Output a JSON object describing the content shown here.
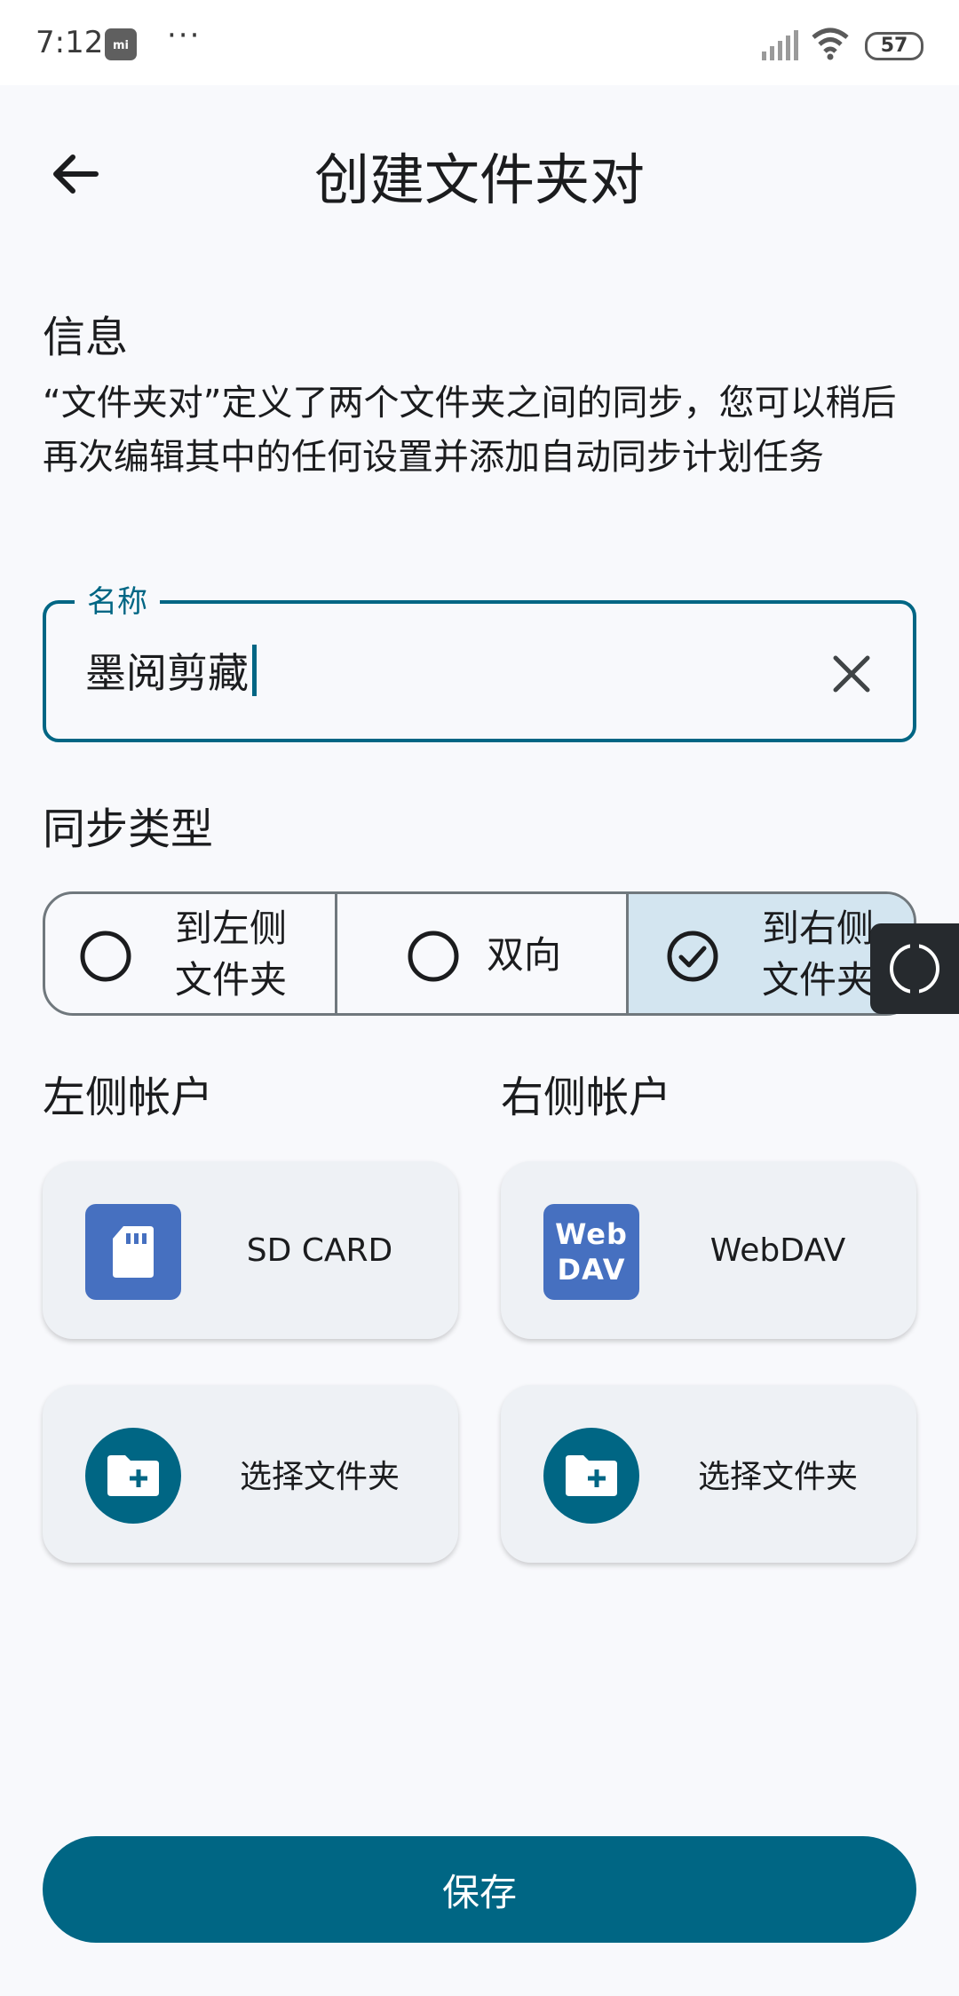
{
  "status_bar": {
    "time": "7:12",
    "more": "···",
    "battery": "57",
    "icons": [
      "mi-store-icon",
      "signal-icon",
      "wifi-icon",
      "battery-icon"
    ]
  },
  "header": {
    "title": "创建文件夹对",
    "back_icon": "arrow-left-icon"
  },
  "info": {
    "label": "信息",
    "description": "“文件夹对”定义了两个文件夹之间的同步，您可以稍后再次编辑其中的任何设置并添加自动同步计划任务"
  },
  "name_field": {
    "label": "名称",
    "value": "墨阅剪藏",
    "clear_icon": "close-icon",
    "accent": "#006684"
  },
  "sync_type": {
    "label": "同步类型",
    "options": [
      {
        "line1": "到左侧",
        "line2": "文件夹",
        "selected": false
      },
      {
        "line1": "双向",
        "line2": "",
        "selected": false
      },
      {
        "line1": "到右侧",
        "line2": "文件夹",
        "selected": true
      }
    ]
  },
  "left_account": {
    "label": "左侧帐户",
    "account_name": "SD CARD",
    "account_icon": "sd-card-icon",
    "folder_label": "选择文件夹",
    "folder_icon": "add-folder-icon"
  },
  "right_account": {
    "label": "右侧帐户",
    "account_name": "WebDAV",
    "account_icon_text_1": "Web",
    "account_icon_text_2": "DAV",
    "folder_label": "选择文件夹",
    "folder_icon": "add-folder-icon"
  },
  "save_button": {
    "label": "保存",
    "color": "#006684"
  },
  "overlay": {
    "icon": "refresh-circle-icon"
  }
}
